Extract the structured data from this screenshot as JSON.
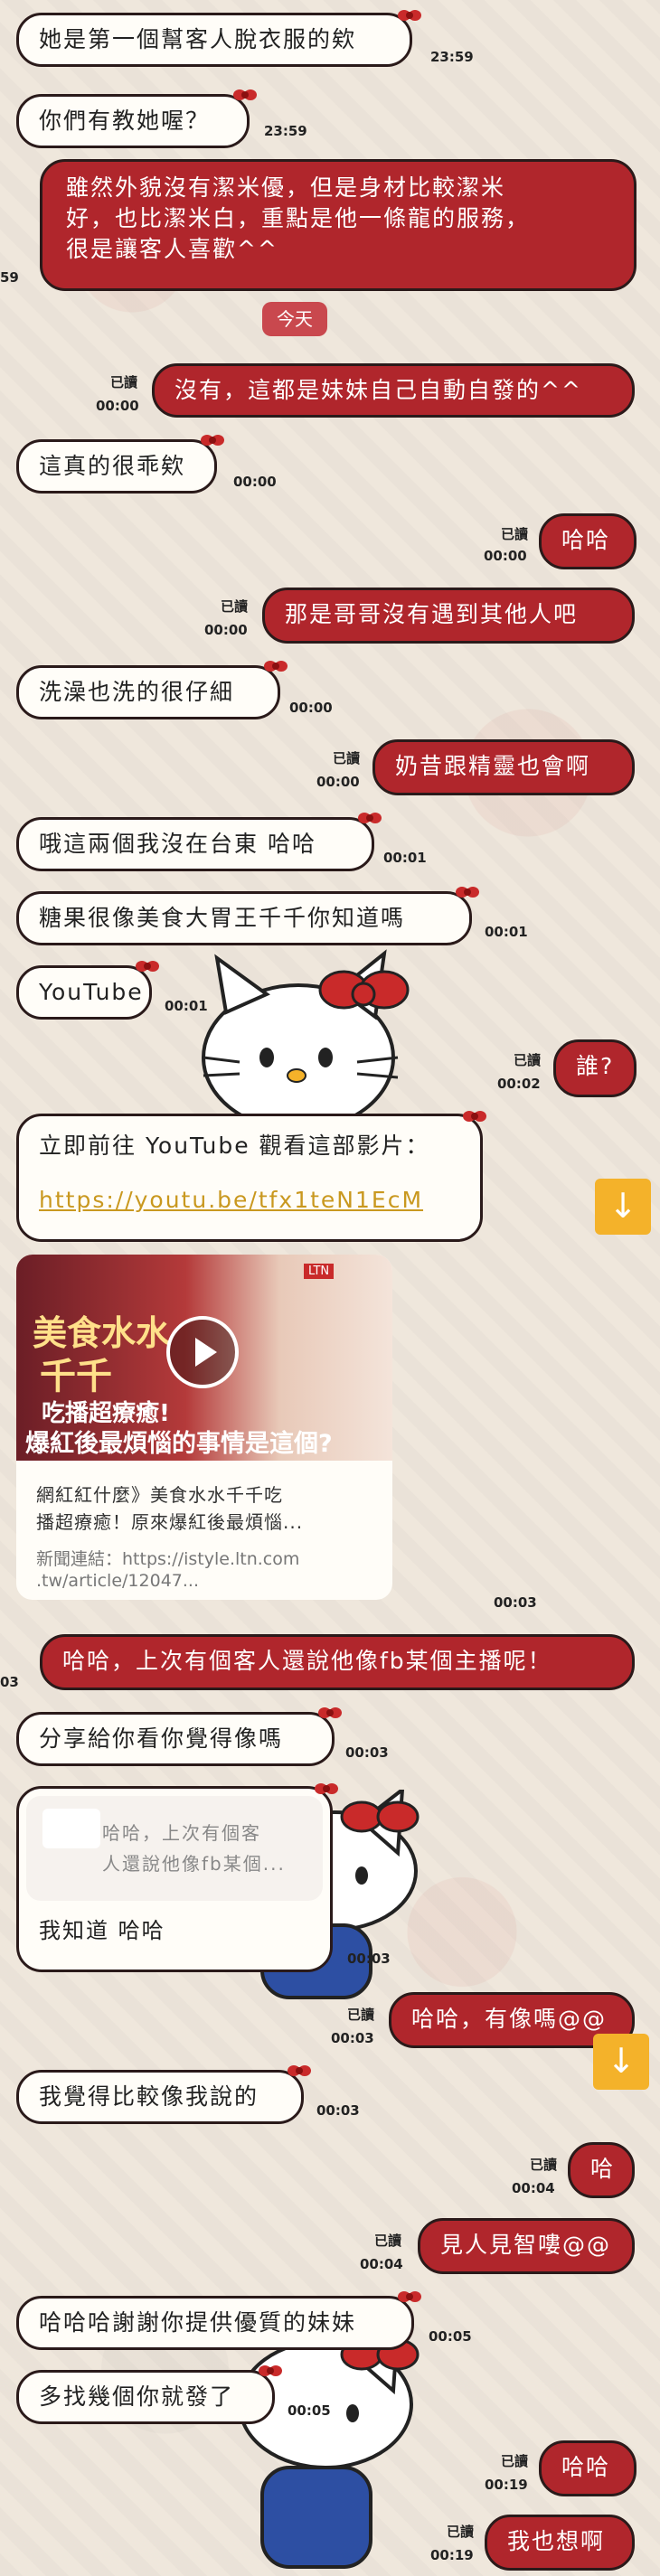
{
  "messages": {
    "m1": {
      "text": "她是第一個幫客人脫衣服的欸",
      "time": "23:59"
    },
    "m2": {
      "text": "你們有教她喔？",
      "time": "23:59"
    },
    "m3": {
      "line1": "雖然外貌沒有潔米優，但是身材比較潔米",
      "line2": "好，也比潔米白，重點是他一條龍的服務，",
      "line3": "很是讓客人喜歡^^",
      "time": "59"
    },
    "date": "今天",
    "m4": {
      "text": "沒有，這都是妹妹自己自動自發的^^",
      "read": "已讀",
      "time": "00:00"
    },
    "m5": {
      "text": "這真的很乖欸",
      "time": "00:00"
    },
    "m6": {
      "text": "哈哈",
      "read": "已讀",
      "time": "00:00"
    },
    "m7": {
      "text": "那是哥哥沒有遇到其他人吧",
      "read": "已讀",
      "time": "00:00"
    },
    "m8": {
      "text": "洗澡也洗的很仔細",
      "time": "00:00"
    },
    "m9": {
      "text": "奶昔跟精靈也會啊",
      "read": "已讀",
      "time": "00:00"
    },
    "m10": {
      "text": "哦這兩個我沒在台東 哈哈",
      "time": "00:01"
    },
    "m11": {
      "text": "糖果很像美食大胃王千千你知道嗎",
      "time": "00:01"
    },
    "m12": {
      "text": "YouTube",
      "time": "00:01"
    },
    "m13": {
      "text": "誰?",
      "read": "已讀",
      "time": "00:02"
    },
    "m14": {
      "line1": "立即前往 YouTube 觀看這部影片：",
      "link": "https://youtu.be/tfx1teN1EcM"
    },
    "preview": {
      "thumb_title1": "美食水水",
      "thumb_title2": "千千",
      "thumb_sub1": "吃播超療癒!",
      "thumb_sub2": "爆紅後最煩惱的事情是這個?",
      "badge": "LTN",
      "desc1": "網紅紅什麼》美食水水千千吃",
      "desc2": "播超療癒！原來爆紅後最煩惱...",
      "url1": "新聞連結：https://istyle.ltn.com",
      "url2": ".tw/article/12047...",
      "time": "00:03"
    },
    "m15": {
      "text": "哈哈，上次有個客人還說他像fb某個主播呢！",
      "time": "03"
    },
    "m16": {
      "text": "分享給你看你覺得像嗎",
      "time": "00:03"
    },
    "m17": {
      "quote1": "哈哈，上次有個客",
      "quote2": "人還說他像fb某個...",
      "text": "我知道 哈哈",
      "time": "00:03"
    },
    "m18": {
      "text": "哈哈，有像嗎@@",
      "read": "已讀",
      "time": "00:03"
    },
    "m19": {
      "text": "我覺得比較像我說的",
      "time": "00:03"
    },
    "m20": {
      "text": "哈",
      "read": "已讀",
      "time": "00:04"
    },
    "m21": {
      "text": "見人見智嘍@@",
      "read": "已讀",
      "time": "00:04"
    },
    "m22": {
      "text": "哈哈哈謝謝你提供優質的妹妹",
      "time": "00:05"
    },
    "m23": {
      "text": "多找幾個你就發了",
      "time": "00:05"
    },
    "m24": {
      "text": "哈哈",
      "read": "已讀",
      "time": "00:19"
    },
    "m25": {
      "text": "我也想啊",
      "read": "已讀",
      "time": "00:19"
    }
  },
  "icons": {
    "scroll_down": "arrow-down-icon",
    "play": "play-icon"
  },
  "colors": {
    "incoming": "#fffdf8",
    "outgoing": "#b0262c",
    "scroll_button": "#f4b22a"
  }
}
